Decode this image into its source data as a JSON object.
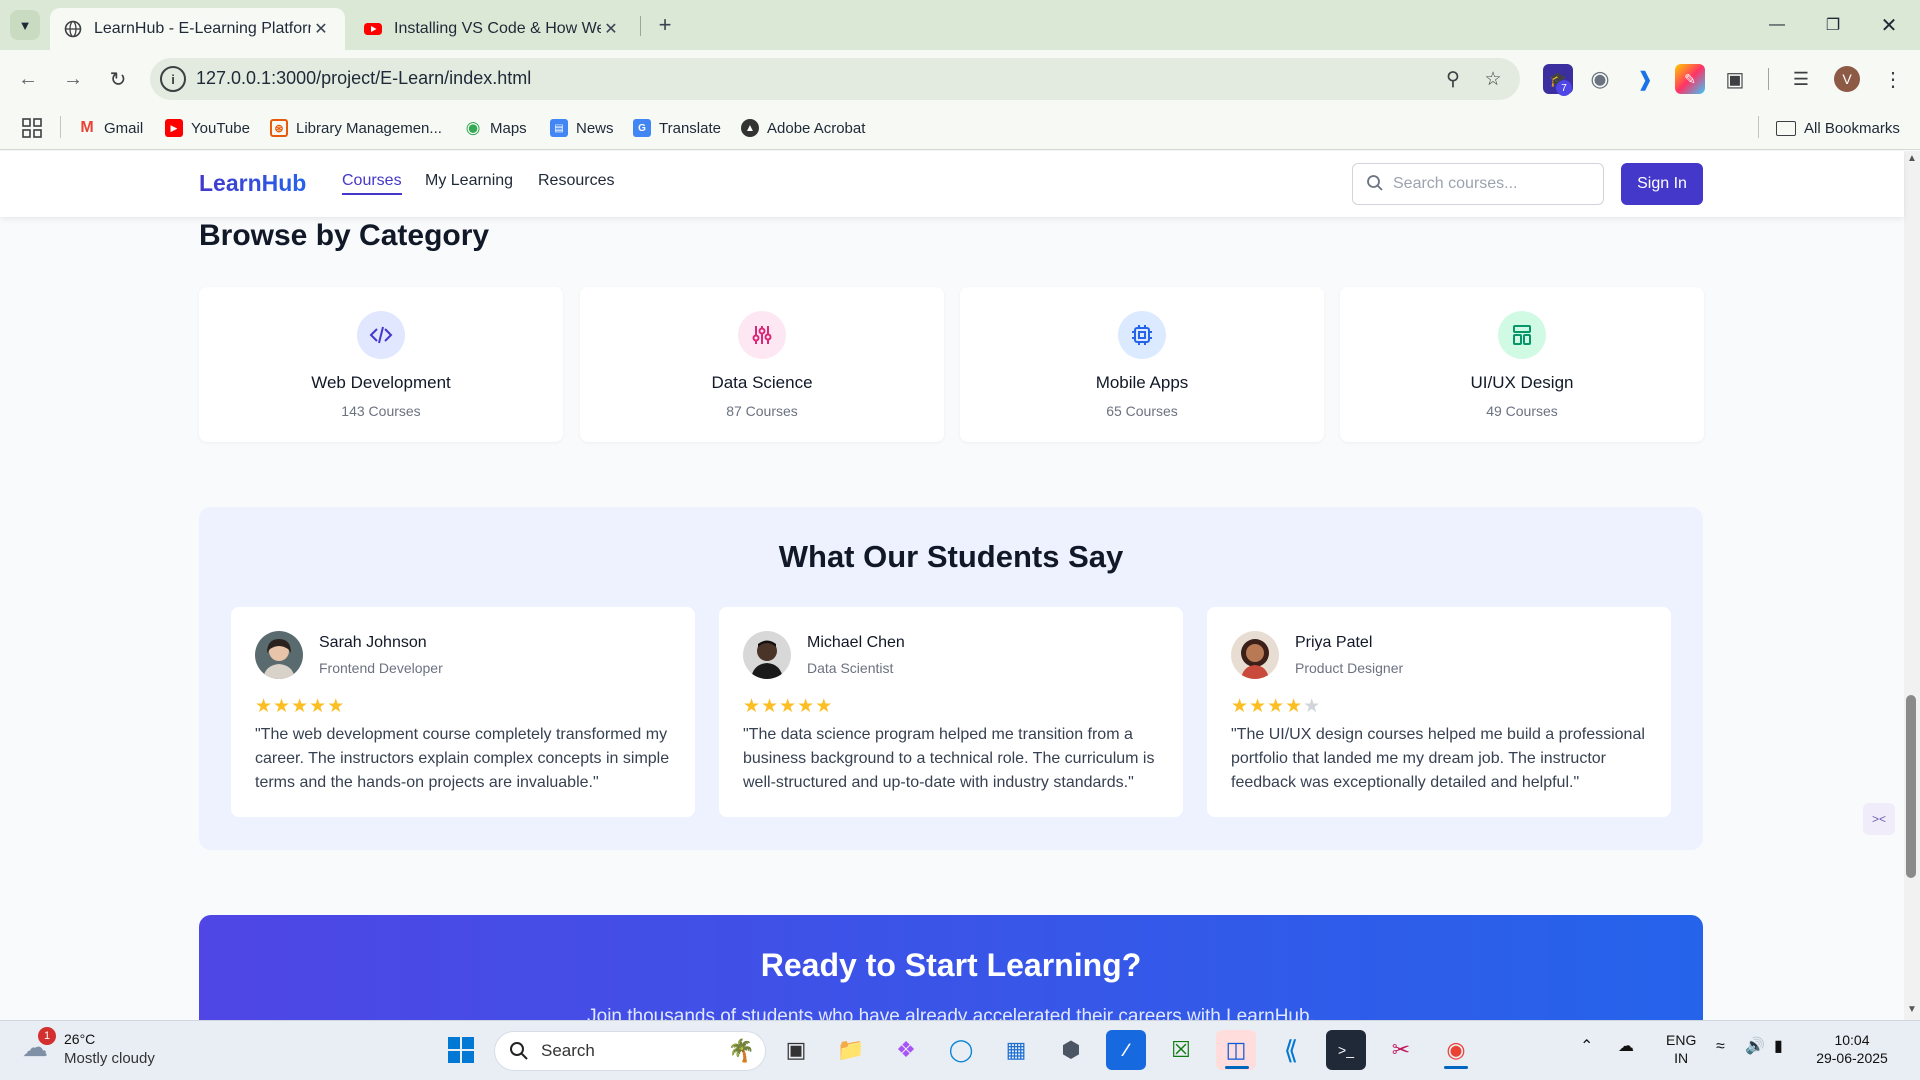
{
  "browser": {
    "tabs": [
      {
        "title": "LearnHub - E-Learning Platform"
      },
      {
        "title": "Installing VS Code & How Websites Work"
      }
    ],
    "url": "127.0.0.1:3000/project/E-Learn/index.html",
    "profile_initial": "V",
    "extension_badge": "7",
    "bookmarks": [
      {
        "label": "Gmail"
      },
      {
        "label": "YouTube"
      },
      {
        "label": "Library Managemen..."
      },
      {
        "label": "Maps"
      },
      {
        "label": "News"
      },
      {
        "label": "Translate"
      },
      {
        "label": "Adobe Acrobat"
      }
    ],
    "all_bookmarks": "All Bookmarks"
  },
  "site": {
    "logo": "LearnHub",
    "nav": [
      {
        "label": "Courses"
      },
      {
        "label": "My Learning"
      },
      {
        "label": "Resources"
      }
    ],
    "search_placeholder": "Search courses...",
    "sign_in": "Sign In"
  },
  "categories": {
    "heading": "Browse by Category",
    "items": [
      {
        "name": "Web Development",
        "count": "143 Courses",
        "icon": "code-icon",
        "tint": "#e0e7ff",
        "color": "#4338ca"
      },
      {
        "name": "Data Science",
        "count": "87 Courses",
        "icon": "sliders-icon",
        "tint": "#fce7f3",
        "color": "#db2777"
      },
      {
        "name": "Mobile Apps",
        "count": "65 Courses",
        "icon": "chip-icon",
        "tint": "#dbeafe",
        "color": "#2563eb"
      },
      {
        "name": "UI/UX Design",
        "count": "49 Courses",
        "icon": "layout-icon",
        "tint": "#d1fae5",
        "color": "#059669"
      }
    ]
  },
  "testimonials": {
    "heading": "What Our Students Say",
    "items": [
      {
        "name": "Sarah Johnson",
        "role": "Frontend Developer",
        "rating": 5,
        "quote": "\"The web development course completely transformed my career. The instructors explain complex concepts in simple terms and the hands-on projects are invaluable.\""
      },
      {
        "name": "Michael Chen",
        "role": "Data Scientist",
        "rating": 5,
        "quote": "\"The data science program helped me transition from a business background to a technical role. The curriculum is well-structured and up-to-date with industry standards.\""
      },
      {
        "name": "Priya Patel",
        "role": "Product Designer",
        "rating": 4,
        "quote": "\"The UI/UX design courses helped me build a professional portfolio that landed me my dream job. The instructor feedback was exceptionally detailed and helpful.\""
      }
    ]
  },
  "cta": {
    "title": "Ready to Start Learning?",
    "subtitle": "Join thousands of students who have already accelerated their careers with LearnHub."
  },
  "taskbar": {
    "weather_temp": "26°C",
    "weather_desc": "Mostly cloudy",
    "weather_badge": "1",
    "search_label": "Search",
    "lang_top": "ENG",
    "lang_bottom": "IN",
    "time": "10:04",
    "date": "29-06-2025"
  }
}
